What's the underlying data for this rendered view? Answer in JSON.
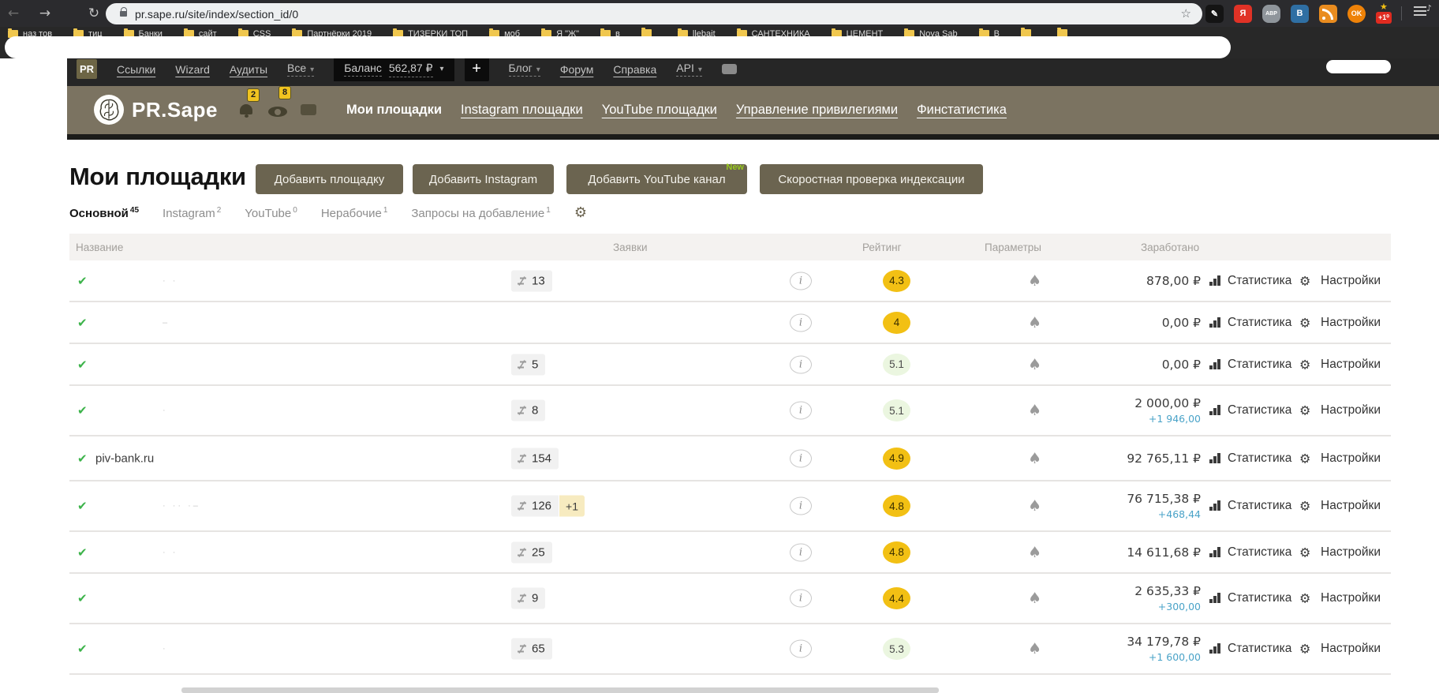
{
  "browser": {
    "url": "pr.sape.ru/site/index/section_id/0",
    "extensions": [
      {
        "name": "editor-extension-icon",
        "glyph": "✎",
        "bg": "#141414",
        "shape": "square"
      },
      {
        "name": "yandex-extension-icon",
        "glyph": "Я",
        "bg": "#e03226",
        "shape": "square"
      },
      {
        "name": "adblock-plus-icon",
        "glyph": "ABP",
        "bg": "#8f959b",
        "shape": "oct"
      },
      {
        "name": "vk-extension-icon",
        "glyph": "B",
        "bg": "#2f6fa3",
        "shape": "square"
      },
      {
        "name": "rss-extension-icon",
        "glyph": "",
        "bg": "#e98c1f",
        "shape": "rss"
      },
      {
        "name": "ok-extension-icon",
        "glyph": "OK",
        "bg": "#ee8208",
        "shape": "circ"
      },
      {
        "name": "plus-one-extension-icon",
        "glyph": "+1⁰",
        "bg": "#e02b20",
        "shape": "star-badge"
      }
    ],
    "bookmarks": [
      "наз тов",
      "тиц",
      "Банки",
      "сайт",
      "CSS",
      "Партнёрки 2019",
      "ТИЗЕРКИ ТОП",
      "моб",
      "Я \"Ж\"",
      "в",
      "",
      "llebait",
      "САНТЕХНИКА",
      "ЦЕМЕНТ",
      "Nova Sab",
      "В",
      "",
      ""
    ]
  },
  "topnav": {
    "brand": "PR",
    "links_left": [
      "Ссылки",
      "Wizard",
      "Аудиты"
    ],
    "all_label": "Все",
    "balance_label": "Баланс",
    "balance_value": "562,87 ₽",
    "plus_label": "+",
    "links_right": [
      "Блог",
      "Форум",
      "Справка",
      "API"
    ]
  },
  "site_header": {
    "brand": "PR.Sape",
    "notifications_badge": "2",
    "views_badge": "8",
    "nav": [
      {
        "label": "Мои площадки",
        "active": true
      },
      {
        "label": "Instagram площадки",
        "active": false
      },
      {
        "label": "YouTube площадки",
        "active": false
      },
      {
        "label": "Управление привилегиями",
        "active": false
      },
      {
        "label": "Финстатистика",
        "active": false
      }
    ]
  },
  "page": {
    "title": "Мои площадки",
    "buttons": [
      {
        "label": "Добавить площадку",
        "badge": ""
      },
      {
        "label": "Добавить Instagram",
        "badge": ""
      },
      {
        "label": "Добавить YouTube канал",
        "badge": "New"
      },
      {
        "label": "Скоростная проверка индексации",
        "badge": ""
      }
    ],
    "tabs": [
      {
        "label": "Основной",
        "count": "45",
        "active": true
      },
      {
        "label": "Instagram",
        "count": "2",
        "active": false
      },
      {
        "label": "YouTube",
        "count": "0",
        "active": false
      },
      {
        "label": "Нерабочие",
        "count": "1",
        "active": false
      },
      {
        "label": "Запросы на добавление",
        "count": "1",
        "active": false
      }
    ]
  },
  "table": {
    "headers": [
      "Название",
      "Заявки",
      "Рейтинг",
      "Параметры",
      "Заработано"
    ],
    "labels": {
      "statistics": "Статистика",
      "settings": "Настройки"
    },
    "rows": [
      {
        "name": "",
        "artifact": "· ·",
        "requests": "13",
        "requests_plus": "",
        "rating": "4.3",
        "rating_style": "yellow",
        "earned": "878,00 ₽",
        "delta": ""
      },
      {
        "name": "",
        "artifact": "–",
        "requests": "",
        "requests_plus": "",
        "rating": "4",
        "rating_style": "yellow",
        "earned": "0,00 ₽",
        "delta": ""
      },
      {
        "name": "",
        "artifact": "",
        "requests": "5",
        "requests_plus": "",
        "rating": "5.1",
        "rating_style": "green",
        "earned": "0,00 ₽",
        "delta": ""
      },
      {
        "name": "",
        "artifact": "·",
        "requests": "8",
        "requests_plus": "",
        "rating": "5.1",
        "rating_style": "green",
        "earned": "2 000,00 ₽",
        "delta": "+1 946,00"
      },
      {
        "name": "piv-bank.ru",
        "artifact": "",
        "requests": "154",
        "requests_plus": "",
        "rating": "4.9",
        "rating_style": "yellow",
        "earned": "92 765,11 ₽",
        "delta": ""
      },
      {
        "name": "",
        "artifact": "· ·· ·–",
        "requests": "126",
        "requests_plus": "+1",
        "rating": "4.8",
        "rating_style": "yellow",
        "earned": "76 715,38 ₽",
        "delta": "+468,44"
      },
      {
        "name": "",
        "artifact": "· ·",
        "requests": "25",
        "requests_plus": "",
        "rating": "4.8",
        "rating_style": "yellow",
        "earned": "14 611,68 ₽",
        "delta": ""
      },
      {
        "name": "",
        "artifact": "",
        "requests": "9",
        "requests_plus": "",
        "rating": "4.4",
        "rating_style": "yellow",
        "earned": "2 635,33 ₽",
        "delta": "+300,00"
      },
      {
        "name": "",
        "artifact": "·",
        "requests": "65",
        "requests_plus": "",
        "rating": "5.3",
        "rating_style": "green",
        "earned": "34 179,78 ₽",
        "delta": "+1 600,00"
      }
    ]
  },
  "colors": {
    "accent_olive": "#6b6450",
    "rating_yellow": "#f2c014",
    "rating_green_bg": "#ebf6e0",
    "delta_blue": "#4aa3c8",
    "check_green": "#3cb34a",
    "badge_yellow": "#f0c320",
    "new_green": "#98ca1e"
  }
}
